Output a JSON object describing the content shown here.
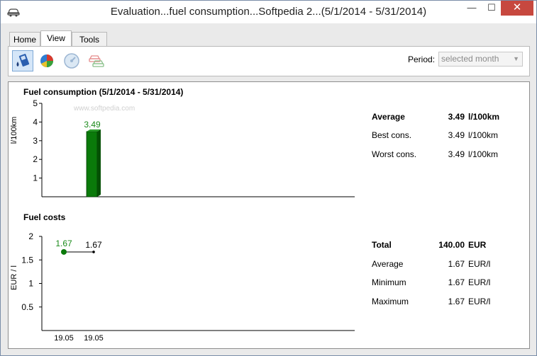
{
  "window": {
    "title": "Evaluation...fuel consumption...Softpedia 2...(5/1/2014 - 5/31/2014)",
    "min_glyph": "—",
    "max_glyph": "☐",
    "close_glyph": "✕"
  },
  "tabs": [
    {
      "label": "Home"
    },
    {
      "label": "View"
    },
    {
      "label": "Tools"
    }
  ],
  "active_tab": "View",
  "toolbar": {
    "buttons": [
      {
        "icon": "fuel-pump-icon"
      },
      {
        "icon": "pie-chart-icon"
      },
      {
        "icon": "speedometer-icon"
      },
      {
        "icon": "cars-icon"
      }
    ],
    "period_label": "Period:",
    "period_value": "selected month"
  },
  "consumption": {
    "title": "Fuel consumption (5/1/2014 - 5/31/2014)",
    "watermark": "www.softpedia.com",
    "stats": {
      "average_label": "Average",
      "average_value": "3.49",
      "average_unit": "l/100km",
      "best_label": "Best cons.",
      "best_value": "3.49",
      "best_unit": "l/100km",
      "worst_label": "Worst cons.",
      "worst_value": "3.49",
      "worst_unit": "l/100km"
    }
  },
  "costs": {
    "title": "Fuel costs",
    "stats": {
      "total_label": "Total",
      "total_value": "140.00",
      "total_unit": "EUR",
      "average_label": "Average",
      "average_value": "1.67",
      "average_unit": "EUR/l",
      "min_label": "Minimum",
      "min_value": "1.67",
      "min_unit": "EUR/l",
      "max_label": "Maximum",
      "max_value": "1.67",
      "max_unit": "EUR/l"
    }
  },
  "colors": {
    "bar_fill": "#0a7a0a",
    "bar_dark": "#045004",
    "label_green": "#1a8a1a",
    "close_red": "#c7483f",
    "selected_button": "#d5e6f8"
  },
  "chart_data": [
    {
      "type": "bar",
      "title": "Fuel consumption (5/1/2014 - 5/31/2014)",
      "xlabel": "",
      "ylabel": "l/100km",
      "ylim": [
        0,
        5
      ],
      "yticks": [
        1,
        2,
        3,
        4,
        5
      ],
      "categories": [
        ""
      ],
      "values": [
        3.49
      ],
      "data_labels": [
        "3.49"
      ],
      "grid": false
    },
    {
      "type": "line",
      "title": "Fuel costs",
      "xlabel": "",
      "ylabel": "EUR / l",
      "ylim": [
        0,
        2
      ],
      "yticks": [
        0.5,
        1,
        1.5,
        2
      ],
      "yticklabels": [
        "0.5",
        "1",
        "1.5",
        "2"
      ],
      "x": [
        "19.05",
        "19.05"
      ],
      "values": [
        1.67,
        1.67
      ],
      "data_labels": [
        "1.67",
        "1.67"
      ],
      "grid": false
    }
  ]
}
